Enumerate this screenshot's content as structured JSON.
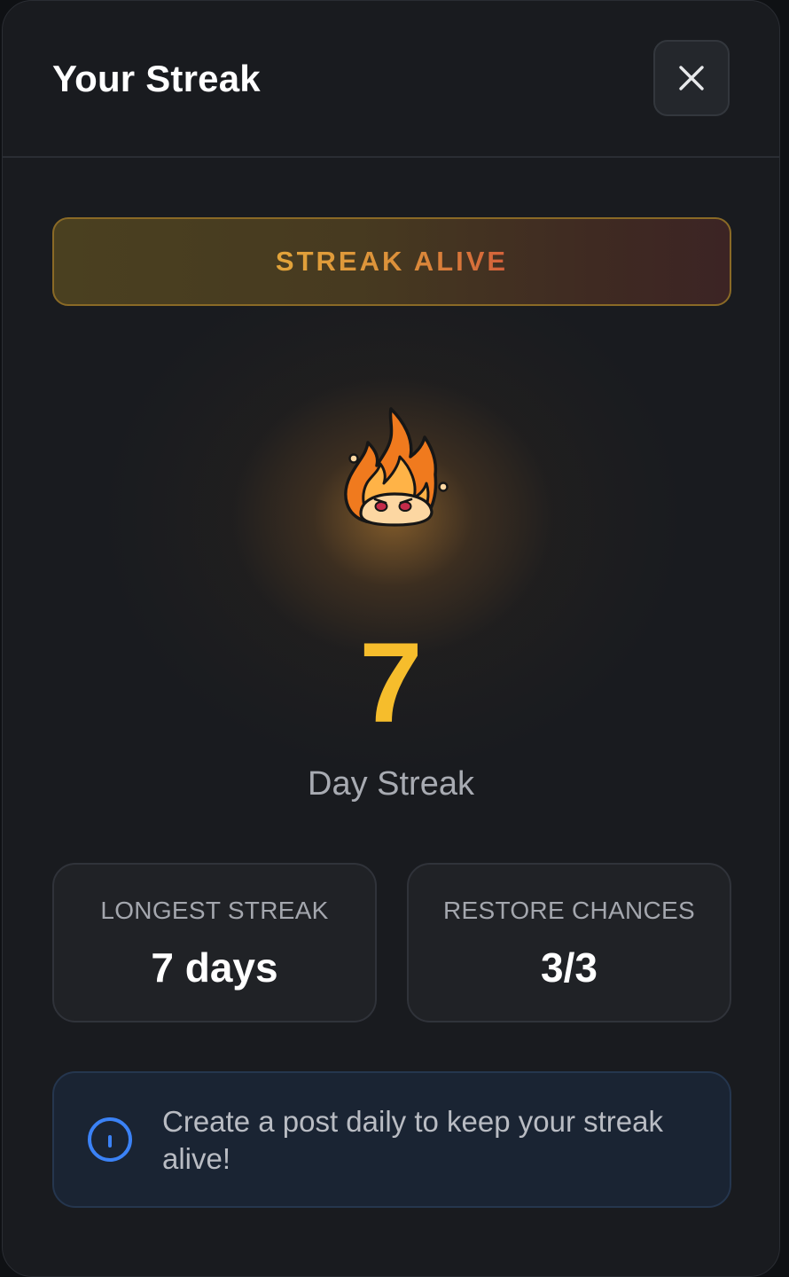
{
  "modal": {
    "title": "Your Streak",
    "close_icon": "close-icon"
  },
  "status": {
    "label": "STREAK ALIVE"
  },
  "streak": {
    "icon": "flame-icon",
    "count": "7",
    "label": "Day Streak"
  },
  "stats": {
    "longest": {
      "label": "LONGEST STREAK",
      "value": "7 days"
    },
    "restore": {
      "label": "RESTORE CHANCES",
      "value": "3/3"
    }
  },
  "info": {
    "icon": "info-icon",
    "text": "Create a post daily to keep your streak alive!"
  },
  "colors": {
    "background": "#191b1f",
    "accent_gold": "#f6bd2c",
    "status_orange": "#e2a43a",
    "info_blue": "#3b82f6"
  }
}
